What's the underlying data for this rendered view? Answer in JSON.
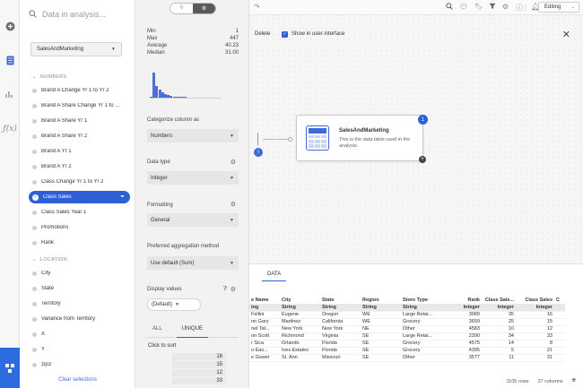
{
  "search": {
    "placeholder": "Data in analysis..."
  },
  "data_table": {
    "selected": "SalesAndMarketing"
  },
  "groups": {
    "numbers": "NUMBERS",
    "location": "LOCATION"
  },
  "fields_numbers": [
    "Brand A Change Yr 1 to Yr 2",
    "Brand A Share Change Yr 1 to ...",
    "Brand A Share Yr 1",
    "Brand A Share Yr 2",
    "Brand A Yr 1",
    "Brand A Yr 2",
    "Class Change Yr 1 to Yr 2",
    "Class Sales",
    "Class Sales Year 1",
    "Promotions",
    "Rank"
  ],
  "fields_location": [
    "City",
    "State",
    "Territory",
    "Variance from Territory",
    "X",
    "Y",
    "zip3"
  ],
  "selected_field": "Class Sales",
  "clear_selection": "Clear selections",
  "stats": [
    {
      "label": "Min",
      "value": "1"
    },
    {
      "label": "Max",
      "value": "447"
    },
    {
      "label": "Average",
      "value": "40.23"
    },
    {
      "label": "Median",
      "value": "31.00"
    }
  ],
  "histogram": [
    0.05,
    0.95,
    0.45,
    0.3,
    0.2,
    0.12,
    0.1,
    0.06,
    0.04,
    0.04,
    0.03,
    0.02,
    0.02
  ],
  "properties": {
    "categorize_label": "Categorize column as",
    "categorize_value": "Numbers",
    "datatype_label": "Data type",
    "datatype_value": "Integer",
    "formatting_label": "Formatting",
    "formatting_value": "General",
    "aggregation_label": "Preferred aggregation method",
    "aggregation_value": "Use default (Sum)",
    "display_label": "Display values",
    "display_value": "(Default)",
    "tab_all": "ALL",
    "tab_unique": "UNIQUE",
    "click_sort": "Click to sort",
    "unique_values": [
      "16",
      "15",
      "12",
      "33"
    ]
  },
  "topbar": {
    "mode": "Editing"
  },
  "editbar": {
    "delete": "Delete",
    "show_ui": "Show in user interface"
  },
  "node": {
    "badge": "1",
    "title": "SalesAndMarketing",
    "desc": "This is the data table used in the analysis."
  },
  "data": {
    "tab": "DATA",
    "headers": [
      "e Name",
      "City",
      "State",
      "Region",
      "Store Type",
      "Rank",
      "Class Sale...",
      "Class Sales",
      "C"
    ],
    "types": [
      "ing",
      "String",
      "String",
      "String",
      "String",
      "Integer",
      "Integer",
      "Integer",
      ""
    ],
    "rows": [
      [
        "Fellini",
        "Eugene",
        "Oregon",
        "WE",
        "Large Retai...",
        "3089",
        "35",
        "16",
        ""
      ],
      [
        "nn Gary",
        "Martinez",
        "California",
        "WE",
        "Grocery",
        "3659",
        "25",
        "15",
        ""
      ],
      [
        "nel Tat...",
        "New York",
        "New York",
        "NE",
        "Other",
        "4583",
        "10",
        "12",
        ""
      ],
      [
        "on Scott",
        "Richmond",
        "Virginia",
        "SE",
        "Large Retai...",
        "2390",
        "34",
        "33",
        ""
      ],
      [
        "r Sica",
        "Orlando",
        "Florida",
        "SE",
        "Grocery",
        "4575",
        "14",
        "8",
        ""
      ],
      [
        "o Eas...",
        "Ives Estates",
        "Florida",
        "SE",
        "Grocery",
        "4395",
        "5",
        "21",
        ""
      ],
      [
        "e Gower",
        "St. Ann",
        "Missouri",
        "SE",
        "Other",
        "3577",
        "11",
        "31",
        ""
      ]
    ],
    "rows_count": "1105 rows",
    "cols_count": "27 columns"
  }
}
